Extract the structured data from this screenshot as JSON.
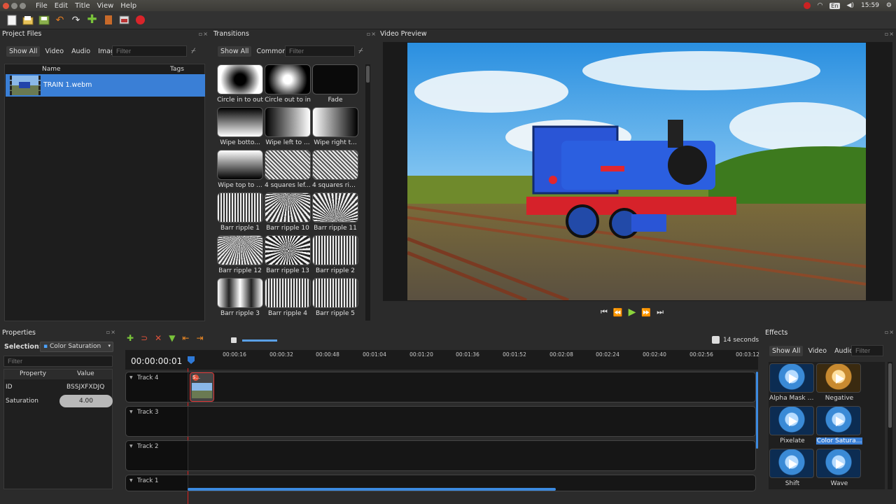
{
  "menu": [
    "File",
    "Edit",
    "Title",
    "View",
    "Help"
  ],
  "system": {
    "lang": "En",
    "clock": "15:59"
  },
  "project_files": {
    "title": "Project Files",
    "tabs": [
      "Show All",
      "Video",
      "Audio",
      "Image"
    ],
    "filter_placeholder": "Filter",
    "columns": [
      "Name",
      "Tags"
    ],
    "rows": [
      {
        "name": "TRAIN 1.webm",
        "tags": ""
      }
    ]
  },
  "transitions": {
    "title": "Transitions",
    "tabs": [
      "Show All",
      "Common"
    ],
    "filter_placeholder": "Filter",
    "items": [
      "Circle in to out",
      "Circle out to in",
      "Fade",
      "Wipe botto...",
      "Wipe left to ...",
      "Wipe right t...",
      "Wipe top to ...",
      "4 squares lef...",
      "4 squares rig...",
      "Barr ripple 1",
      "Barr ripple 10",
      "Barr ripple 11",
      "Barr ripple 12",
      "Barr ripple 13",
      "Barr ripple 2",
      "Barr ripple 3",
      "Barr ripple 4",
      "Barr ripple 5"
    ]
  },
  "video_preview": {
    "title": "Video Preview"
  },
  "properties": {
    "title": "Properties",
    "selection_label": "Selection:",
    "selection_value": "Color Saturation",
    "filter_placeholder": "Filter",
    "columns": [
      "Property",
      "Value"
    ],
    "rows": [
      {
        "property": "ID",
        "value": "BSSJXFXDJQ"
      },
      {
        "property": "Saturation",
        "value": "4.00"
      }
    ]
  },
  "timeline": {
    "timecode": "00:00:00:01",
    "zoom_label": "14 seconds",
    "ticks": [
      "00:00:16",
      "00:00:32",
      "00:00:48",
      "00:01:04",
      "00:01:20",
      "00:01:36",
      "00:01:52",
      "00:02:08",
      "00:02:24",
      "00:02:40",
      "00:02:56",
      "00:03:12"
    ],
    "tracks": [
      "Track 4",
      "Track 3",
      "Track 2",
      "Track 1"
    ],
    "clip_badge": "S..."
  },
  "effects": {
    "title": "Effects",
    "tabs": [
      "Show All",
      "Video",
      "Audio"
    ],
    "filter_placeholder": "Filter",
    "items": [
      "Alpha Mask /...",
      "Negative",
      "Pixelate",
      "Color Satura...",
      "Shift",
      "Wave"
    ]
  }
}
